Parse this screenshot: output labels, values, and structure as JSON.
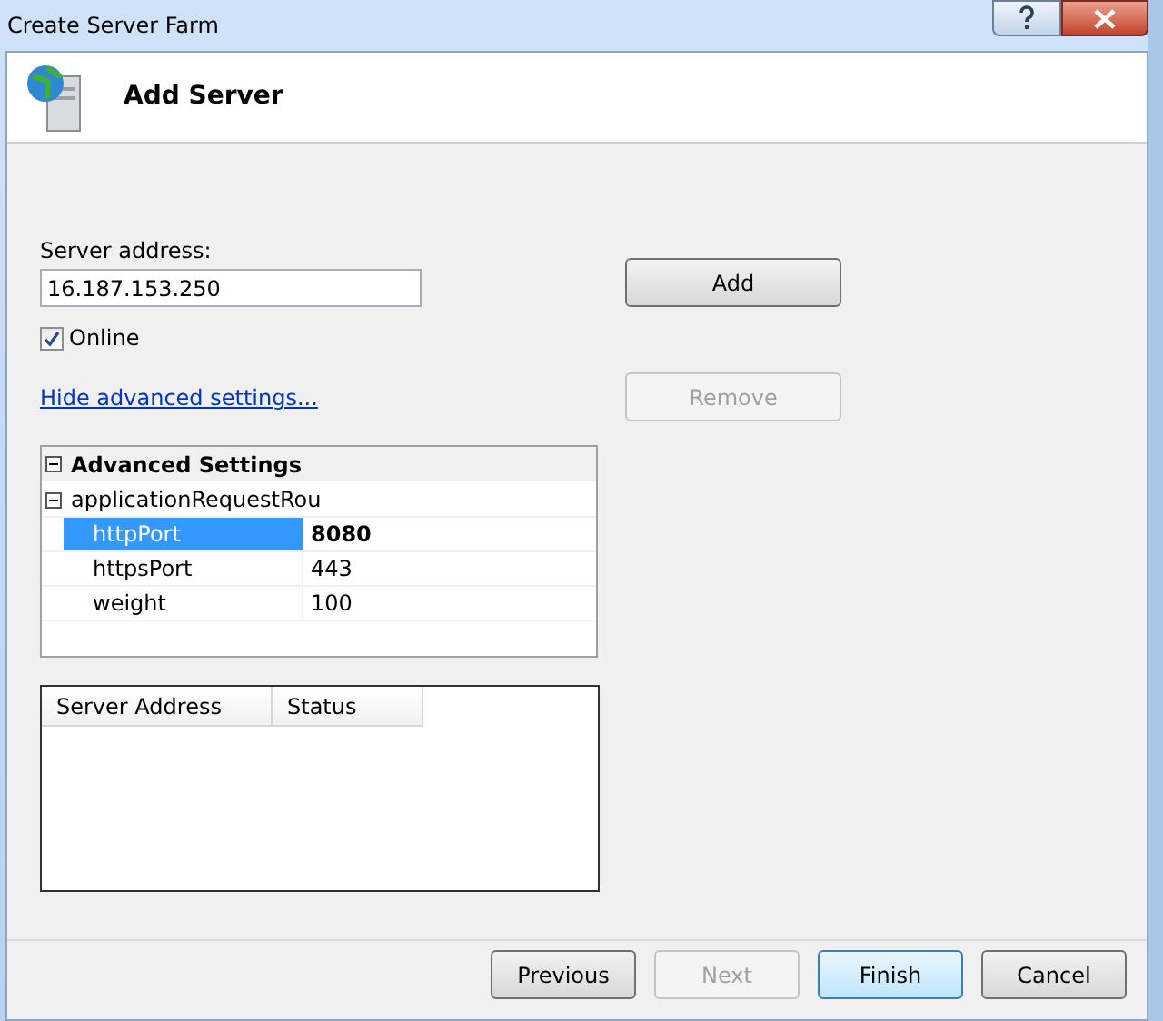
{
  "window": {
    "title": "Create Server Farm"
  },
  "header": {
    "title": "Add Server"
  },
  "server_address": {
    "label": "Server address:",
    "value": "16.187.153.250"
  },
  "online": {
    "label": "Online",
    "checked": true
  },
  "advanced_link": "Hide advanced settings...",
  "buttons": [
    {
      "label": "Add",
      "disabled": false
    },
    {
      "label": "Remove",
      "disabled": true
    }
  ],
  "property_grid": {
    "category": "Advanced Settings",
    "expanded": true,
    "group": {
      "label": "applicationRequestRou",
      "expanded": true,
      "properties": [
        {
          "name": "httpPort",
          "value": "8080",
          "selected": true,
          "modified": true
        },
        {
          "name": "httpsPort",
          "value": "443",
          "selected": false,
          "modified": false
        },
        {
          "name": "weight",
          "value": "100",
          "selected": false,
          "modified": false
        }
      ]
    }
  },
  "table": {
    "columns": [
      "Server Address",
      "Status"
    ]
  },
  "footer_buttons": [
    {
      "label": "Previous",
      "disabled": false,
      "default": false
    },
    {
      "label": "Next",
      "disabled": true,
      "default": false
    },
    {
      "label": "Finish",
      "disabled": false,
      "default": true
    },
    {
      "label": "Cancel",
      "disabled": false,
      "default": false
    }
  ]
}
